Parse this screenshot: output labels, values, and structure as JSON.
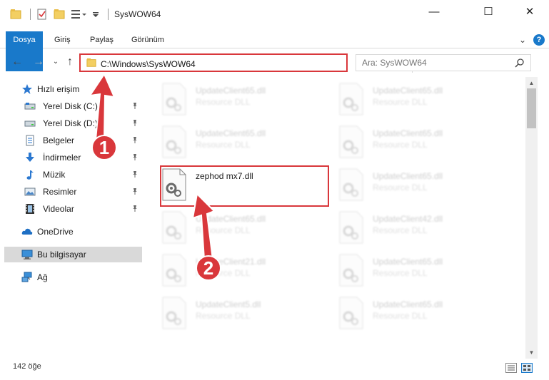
{
  "window": {
    "title": "SysWOW64",
    "minimize_glyph": "—",
    "maximize_glyph": "☐",
    "close_glyph": "✕"
  },
  "ribbon": {
    "tabs": [
      {
        "label": "Dosya",
        "active": true
      },
      {
        "label": "Giriş",
        "active": false
      },
      {
        "label": "Paylaş",
        "active": false
      },
      {
        "label": "Görünüm",
        "active": false
      }
    ],
    "expand_glyph": "⌄",
    "help_glyph": "?"
  },
  "nav": {
    "back_glyph": "←",
    "forward_glyph": "→",
    "recent_glyph": "⌄",
    "up_glyph": "↑"
  },
  "address": {
    "path": "C:\\Windows\\SysWOW64",
    "dropdown_glyph": "⌄",
    "refresh_glyph": "↻"
  },
  "search": {
    "placeholder": "Ara: SysWOW64"
  },
  "sidebar": {
    "items": [
      {
        "label": "Hızlı erişim",
        "icon": "star-icon"
      },
      {
        "label": "Yerel Disk (C:)",
        "icon": "drive-icon",
        "pinned": true
      },
      {
        "label": "Yerel Disk (D:)",
        "icon": "drive-icon",
        "pinned": true
      },
      {
        "label": "Belgeler",
        "icon": "documents-icon",
        "pinned": true
      },
      {
        "label": "İndirmeler",
        "icon": "download-icon",
        "pinned": true
      },
      {
        "label": "Müzik",
        "icon": "music-icon",
        "pinned": true
      },
      {
        "label": "Resimler",
        "icon": "pictures-icon",
        "pinned": true
      },
      {
        "label": "Videolar",
        "icon": "videos-icon",
        "pinned": true
      },
      {
        "label": "OneDrive",
        "icon": "cloud-icon"
      },
      {
        "label": "Bu bilgisayar",
        "icon": "computer-icon",
        "selected": true
      },
      {
        "label": "Ağ",
        "icon": "network-icon"
      }
    ],
    "pin_glyph": "📌"
  },
  "files": [
    {
      "name": "UpdateClient65.dll",
      "type": "Resource DLL",
      "faded": true
    },
    {
      "name": "UpdateClient65.dll",
      "type": "Resource DLL",
      "faded": true
    },
    {
      "name": "UpdateClient65.dll",
      "type": "Resource DLL",
      "faded": true
    },
    {
      "name": "UpdateClient65.dll",
      "type": "Resource DLL",
      "faded": true
    },
    {
      "name": "zephod mx7.dll",
      "type": "",
      "faded": false
    },
    {
      "name": "UpdateClient65.dll",
      "type": "Resource DLL",
      "faded": true
    },
    {
      "name": "UpdateClient65.dll",
      "type": "Resource DLL",
      "faded": true
    },
    {
      "name": "UpdateClient42.dll",
      "type": "Resource DLL",
      "faded": true
    },
    {
      "name": "UpdateClient21.dll",
      "type": "Resource DLL",
      "faded": true
    },
    {
      "name": "UpdateClient65.dll",
      "type": "Resource DLL",
      "faded": true
    },
    {
      "name": "UpdateClient5.dll",
      "type": "Resource DLL",
      "faded": true
    },
    {
      "name": "UpdateClient65.dll",
      "type": "Resource DLL",
      "faded": true
    }
  ],
  "status": {
    "count": "142 öğe"
  },
  "annotations": {
    "step1": "1",
    "step2": "2",
    "color": "#d9373b"
  }
}
